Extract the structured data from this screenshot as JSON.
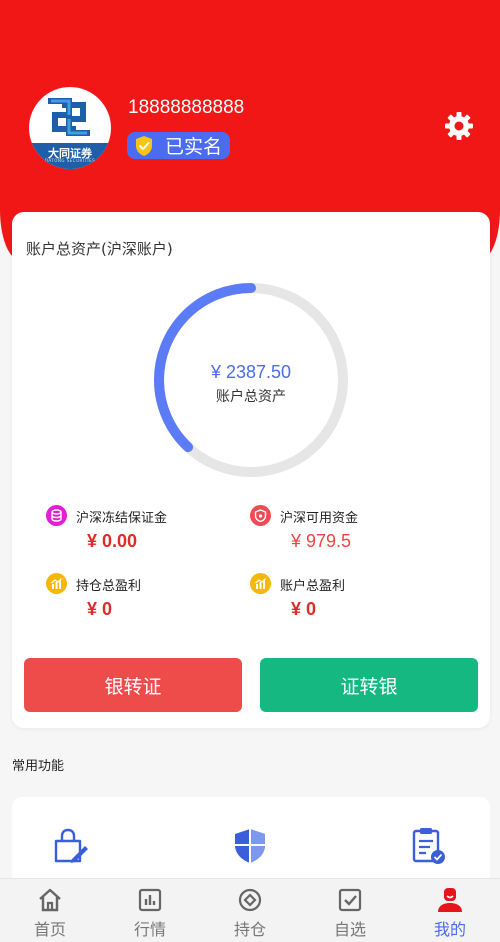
{
  "header": {
    "brand_name": "大同证券",
    "brand_sub": "DATONG SECURITIES",
    "phone": "18888888888",
    "verified_label": "已实名",
    "colors": {
      "header_bg": "#f21717",
      "badge_bg": "#4b6cf0"
    }
  },
  "account": {
    "title": "账户总资产(沪深账户)",
    "total_amount": "¥ 2387.50",
    "total_label": "账户总资产",
    "ring_progress": 0.38,
    "stats": [
      {
        "label": "沪深冻结保证金",
        "value": "¥ 0.00",
        "icon": "database-icon",
        "color": "#e21ed6"
      },
      {
        "label": "沪深可用资金",
        "value": "¥ 979.5",
        "icon": "wallet-shield-icon",
        "color": "#ee4b55"
      },
      {
        "label": "持仓总盈利",
        "value": "¥ 0",
        "icon": "profit-chart-icon",
        "color": "#f5b70a"
      },
      {
        "label": "账户总盈利",
        "value": "¥ 0",
        "icon": "profit-chart-icon",
        "color": "#f5b70a"
      }
    ],
    "buttons": {
      "bank_to_securities": "银转证",
      "securities_to_bank": "证转银"
    },
    "colors": {
      "ring": "#5b7cf6",
      "ring_track": "#e6e6e6",
      "bank_btn": "#ee4b4b",
      "sec_btn": "#16b882"
    }
  },
  "functions": {
    "title": "常用功能",
    "icons": [
      "bag-edit-icon",
      "shield-icon",
      "clipboard-check-icon"
    ]
  },
  "tabbar": {
    "items": [
      {
        "label": "首页",
        "icon": "home-icon"
      },
      {
        "label": "行情",
        "icon": "chart-icon"
      },
      {
        "label": "持仓",
        "icon": "target-icon"
      },
      {
        "label": "自选",
        "icon": "checkbox-icon"
      },
      {
        "label": "我的",
        "icon": "user-icon",
        "active": true
      }
    ],
    "colors": {
      "active": "#4b6cf0",
      "inactive": "#777777"
    }
  }
}
